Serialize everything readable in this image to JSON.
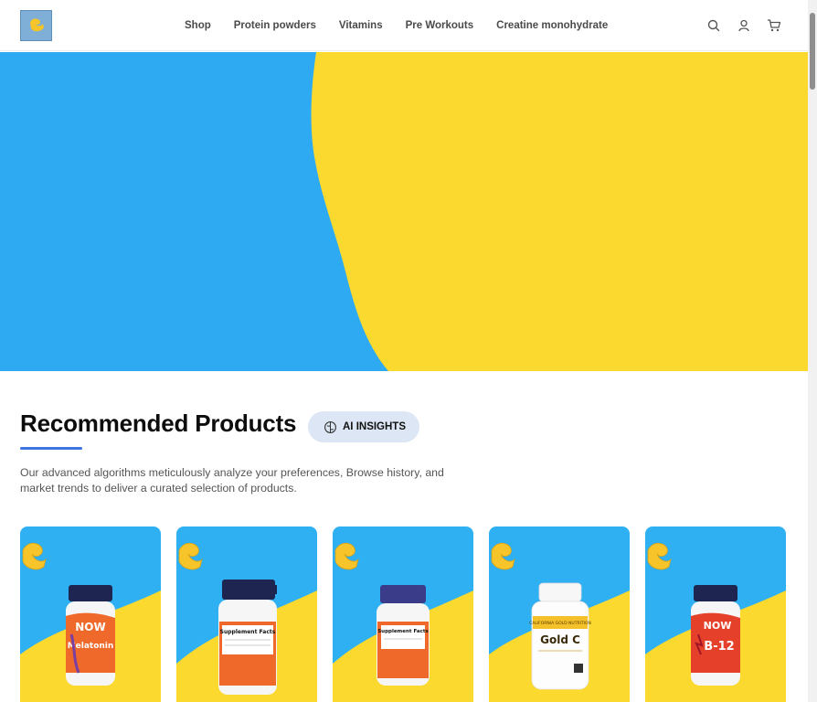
{
  "header": {
    "nav": [
      "Shop",
      "Protein powders",
      "Vitamins",
      "Pre Workouts",
      "Creatine monohydrate"
    ],
    "icons": [
      "search-icon",
      "user-icon",
      "cart-icon"
    ]
  },
  "colors": {
    "hero_blue": "#2eaaf2",
    "hero_yellow": "#fcd92e",
    "accent": "#3d74df",
    "pill_bg": "#dde6f4"
  },
  "recommended": {
    "title": "Recommended Products",
    "ai_button": "AI INSIGHTS",
    "description": "Our advanced algorithms meticulously analyze your preferences, Browse history, and market trends to deliver a curated selection of products."
  },
  "products": [
    {
      "brand": "NOW",
      "name": "Melatonin",
      "cap": "#1e2550",
      "label": "#ef6a2a"
    },
    {
      "brand": "",
      "name": "Supplement Facts",
      "cap": "#1e2550",
      "label": "#ef6a2a"
    },
    {
      "brand": "",
      "name": "Supplement Facts",
      "cap": "#3a3c8a",
      "label": "#ef6a2a"
    },
    {
      "brand": "CALIFORNIA GOLD NUTRITION",
      "name": "Gold C",
      "cap": "#f7f7f7",
      "label": "#f5c12a"
    },
    {
      "brand": "NOW",
      "name": "B-12",
      "cap": "#1e2550",
      "label": "#e5402a"
    }
  ]
}
